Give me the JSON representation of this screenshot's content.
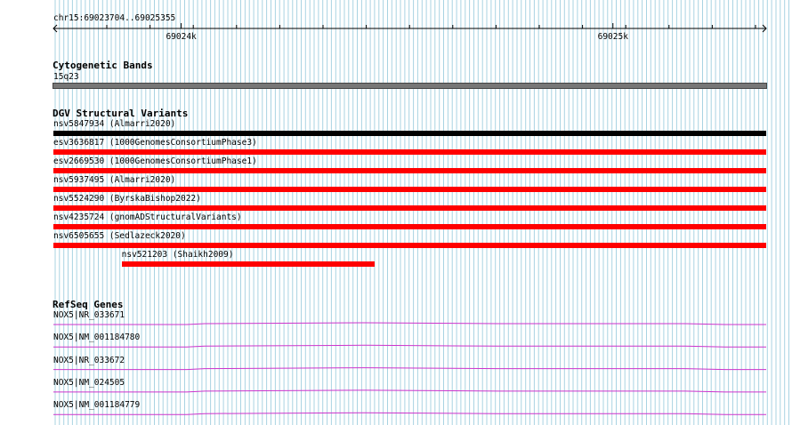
{
  "ruler": {
    "region": "chr15:69023704..69025355",
    "start": 69023704,
    "end": 69025355,
    "ticks": [
      {
        "pos": 69024000,
        "label": "69024k"
      },
      {
        "pos": 69025000,
        "label": "69025k"
      }
    ]
  },
  "tracks": {
    "cytoband": {
      "title": "Cytogenetic Bands",
      "band_label": "15q23",
      "band_color": "#777777"
    },
    "dgv": {
      "title": "DGV Structural Variants",
      "variants": [
        {
          "label": "nsv5847934 (Almarri2020)",
          "color": "#000000",
          "start": 69023704,
          "end": 69025355
        },
        {
          "label": "esv3636817 (1000GenomesConsortiumPhase3)",
          "color": "#ff0000",
          "start": 69023704,
          "end": 69025355
        },
        {
          "label": "esv2669530 (1000GenomesConsortiumPhase1)",
          "color": "#ff0000",
          "start": 69023704,
          "end": 69025355
        },
        {
          "label": "nsv5937495 (Almarri2020)",
          "color": "#ff0000",
          "start": 69023704,
          "end": 69025355
        },
        {
          "label": "nsv5524290 (ByrskaBishop2022)",
          "color": "#ff0000",
          "start": 69023704,
          "end": 69025355
        },
        {
          "label": "nsv4235724 (gnomADStructuralVariants)",
          "color": "#ff0000",
          "start": 69023704,
          "end": 69025355
        },
        {
          "label": "nsv6505655 (Sedlazeck2020)",
          "color": "#ff0000",
          "start": 69023704,
          "end": 69025355
        },
        {
          "label": "nsv521203 (Shaikh2009)",
          "color": "#ff0000",
          "start": 69023862,
          "end": 69024448
        }
      ]
    },
    "refseq": {
      "title": "RefSeq Genes",
      "color": "#cc33cc",
      "genes": [
        {
          "label": "NOX5|NR_033671"
        },
        {
          "label": "NOX5|NM_001184780"
        },
        {
          "label": "NOX5|NR_033672"
        },
        {
          "label": "NOX5|NM_024505"
        },
        {
          "label": "NOX5|NM_001184779"
        }
      ]
    }
  }
}
